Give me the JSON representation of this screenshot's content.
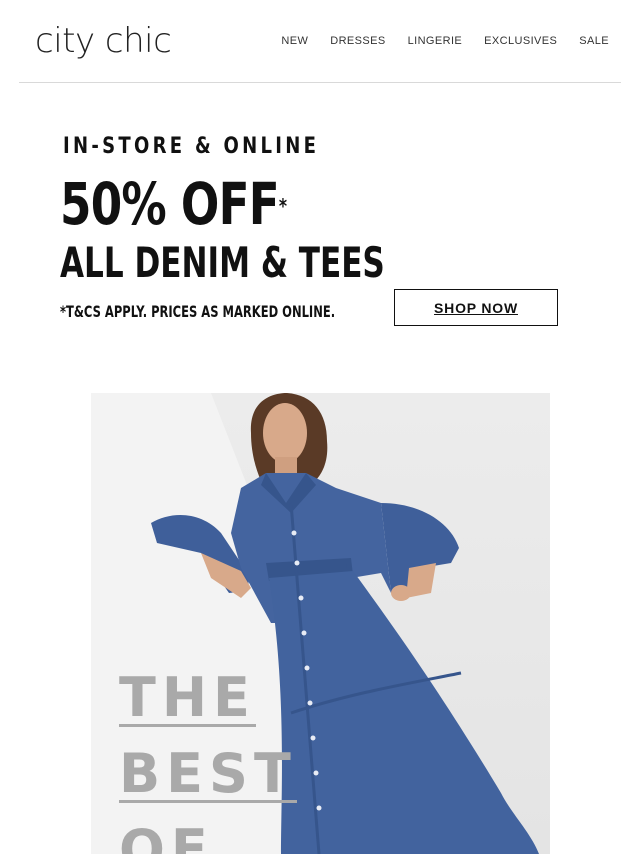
{
  "header": {
    "logo_text": "city chic",
    "nav": [
      "NEW",
      "DRESSES",
      "LINGERIE",
      "EXCLUSIVES",
      "SALE"
    ]
  },
  "promo": {
    "kicker": "IN-STORE & ONLINE",
    "headline": "50% OFF",
    "headline_mark": "*",
    "subheadline": "ALL DENIM & TEES",
    "terms": "*T&CS APPLY. PRICES AS MARKED ONLINE.",
    "cta_label": "SHOP NOW"
  },
  "hero": {
    "overlay_lines": [
      "THE",
      "BEST",
      "OF"
    ],
    "colors": {
      "background": "#e8e8e8",
      "denim": "#3f5f9a",
      "overlay_text": "#a9a9a9"
    }
  }
}
